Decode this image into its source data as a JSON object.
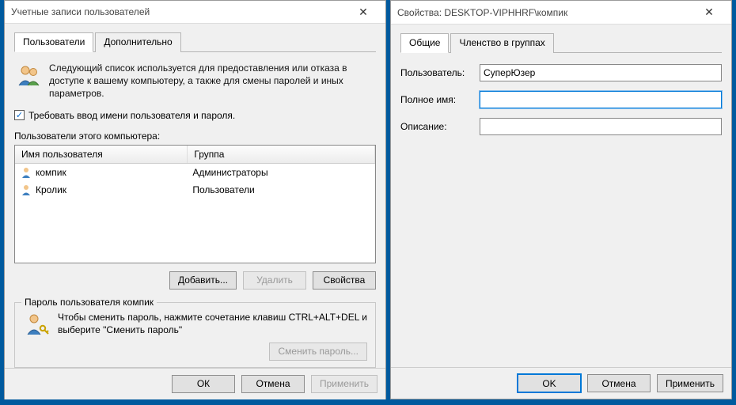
{
  "left": {
    "title": "Учетные записи пользователей",
    "tabs": {
      "users": "Пользователи",
      "advanced": "Дополнительно"
    },
    "intro": "Следующий список используется для предоставления или отказа в доступе к вашему компьютеру, а также для смены паролей и иных параметров.",
    "require_login": "Требовать ввод имени пользователя и пароля.",
    "list_label": "Пользователи этого компьютера:",
    "columns": {
      "name": "Имя пользователя",
      "group": "Группа"
    },
    "rows": [
      {
        "name": "компик",
        "group": "Администраторы"
      },
      {
        "name": "Кролик",
        "group": "Пользователи"
      }
    ],
    "buttons": {
      "add": "Добавить...",
      "delete": "Удалить",
      "props": "Свойства"
    },
    "pwd_group_title": "Пароль пользователя компик",
    "pwd_hint": "Чтобы сменить пароль, нажмите сочетание клавиш CTRL+ALT+DEL и выберите \"Сменить пароль\"",
    "pwd_btn": "Сменить пароль...",
    "footer": {
      "ok": "ОК",
      "cancel": "Отмена",
      "apply": "Применить"
    }
  },
  "right": {
    "title": "Свойства: DESKTOP-VIPHHRF\\компик",
    "tabs": {
      "general": "Общие",
      "membership": "Членство в группах"
    },
    "labels": {
      "user": "Пользователь:",
      "fullname": "Полное имя:",
      "desc": "Описание:"
    },
    "values": {
      "user": "СуперЮзер",
      "fullname": "",
      "desc": ""
    },
    "footer": {
      "ok": "OK",
      "cancel": "Отмена",
      "apply": "Применить"
    }
  }
}
